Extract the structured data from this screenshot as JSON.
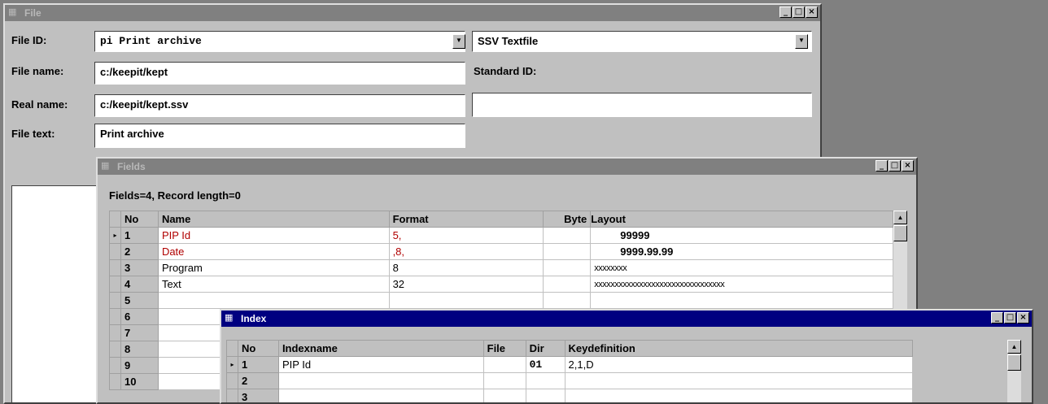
{
  "file_window": {
    "title": "File",
    "file_id_label": "File ID:",
    "file_id_value": "pi  Print archive",
    "file_type_value": "SSV Textfile",
    "file_name_label": "File name:",
    "file_name_value": "c:/keepit/kept",
    "standard_id_label": "Standard ID:",
    "real_name_label": "Real name:",
    "real_name_value": "c:/keepit/kept.ssv",
    "standard_id_value": "",
    "file_text_label": "File text:",
    "file_text_value": "Print archive"
  },
  "fields_window": {
    "title": "Fields",
    "summary": "Fields=4, Record length=0",
    "columns": [
      "No",
      "Name",
      "Format",
      "Byte",
      "Layout"
    ],
    "rows": [
      {
        "no": "1",
        "name": "PIP Id",
        "format": "5,",
        "byte": "",
        "layout": "99999",
        "red": true,
        "current": true
      },
      {
        "no": "2",
        "name": "Date",
        "format": ",8,",
        "byte": "",
        "layout": "9999.99.99",
        "red": true
      },
      {
        "no": "3",
        "name": "Program",
        "format": "8",
        "byte": "",
        "layout": "xxxxxxxx"
      },
      {
        "no": "4",
        "name": "Text",
        "format": "32",
        "byte": "",
        "layout": "xxxxxxxxxxxxxxxxxxxxxxxxxxxxxxxx"
      },
      {
        "no": "5",
        "name": "",
        "format": "",
        "byte": "",
        "layout": ""
      },
      {
        "no": "6",
        "name": "",
        "format": "",
        "byte": "",
        "layout": ""
      },
      {
        "no": "7",
        "name": "",
        "format": "",
        "byte": "",
        "layout": ""
      },
      {
        "no": "8",
        "name": "",
        "format": "",
        "byte": "",
        "layout": ""
      },
      {
        "no": "9",
        "name": "",
        "format": "",
        "byte": "",
        "layout": ""
      },
      {
        "no": "10",
        "name": "",
        "format": "",
        "byte": "",
        "layout": ""
      }
    ]
  },
  "index_window": {
    "title": "Index",
    "columns": [
      "No",
      "Indexname",
      "File",
      "Dir",
      "Keydefinition"
    ],
    "rows": [
      {
        "no": "1",
        "indexname": "PIP Id",
        "file": "",
        "dir": "01",
        "keydef": "2,1,D",
        "current": true
      },
      {
        "no": "2",
        "indexname": "",
        "file": "",
        "dir": "",
        "keydef": ""
      },
      {
        "no": "3",
        "indexname": "",
        "file": "",
        "dir": "",
        "keydef": ""
      }
    ]
  },
  "icons": {
    "minimize": "_",
    "maximize": "□",
    "close": "×",
    "dropdown": "▼",
    "row_pointer": "▸",
    "scroll_up": "▲"
  }
}
